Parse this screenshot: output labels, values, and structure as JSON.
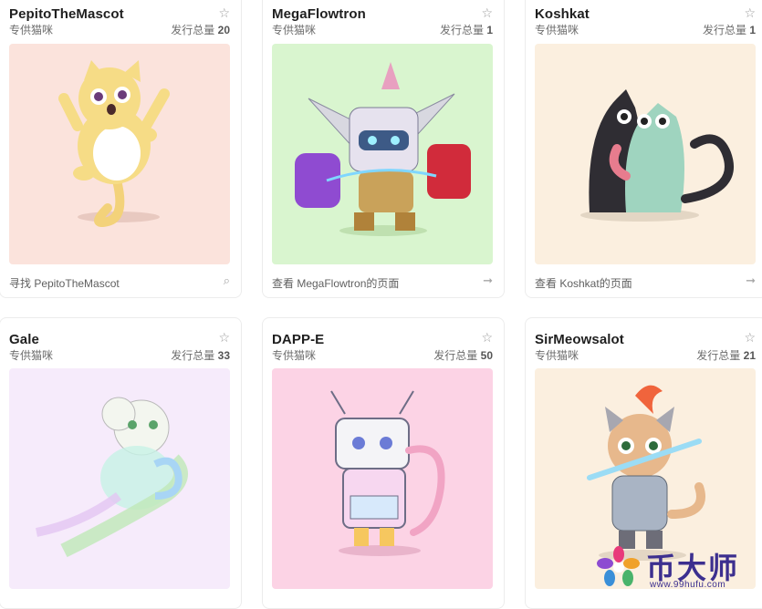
{
  "cards": [
    {
      "name": "PepitoTheMascot",
      "subtitle": "专供猫咪",
      "edition_label": "发行总量",
      "edition_count": "20",
      "footer": "寻找 PepitoTheMascot",
      "footer_icon": "search-icon",
      "bg": "#fbe3dc"
    },
    {
      "name": "MegaFlowtron",
      "subtitle": "专供猫咪",
      "edition_label": "发行总量",
      "edition_count": "1",
      "footer": "查看 MegaFlowtron的页面",
      "footer_icon": "arrow-right-icon",
      "bg": "#d9f5cf"
    },
    {
      "name": "Koshkat",
      "subtitle": "专供猫咪",
      "edition_label": "发行总量",
      "edition_count": "1",
      "footer": "查看 Koshkat的页面",
      "footer_icon": "arrow-right-icon",
      "bg": "#fbefdf"
    },
    {
      "name": "Gale",
      "subtitle": "专供猫咪",
      "edition_label": "发行总量",
      "edition_count": "33",
      "footer": "",
      "footer_icon": "",
      "bg": "#f6ebfb"
    },
    {
      "name": "DAPP-E",
      "subtitle": "专供猫咪",
      "edition_label": "发行总量",
      "edition_count": "50",
      "footer": "",
      "footer_icon": "",
      "bg": "#fcd3e5"
    },
    {
      "name": "SirMeowsalot",
      "subtitle": "专供猫咪",
      "edition_label": "发行总量",
      "edition_count": "21",
      "footer": "",
      "footer_icon": "",
      "bg": "#fbefdf"
    }
  ],
  "star_glyph": "☆",
  "watermark": {
    "text": "币大师",
    "url": "www.99hufu.com"
  }
}
